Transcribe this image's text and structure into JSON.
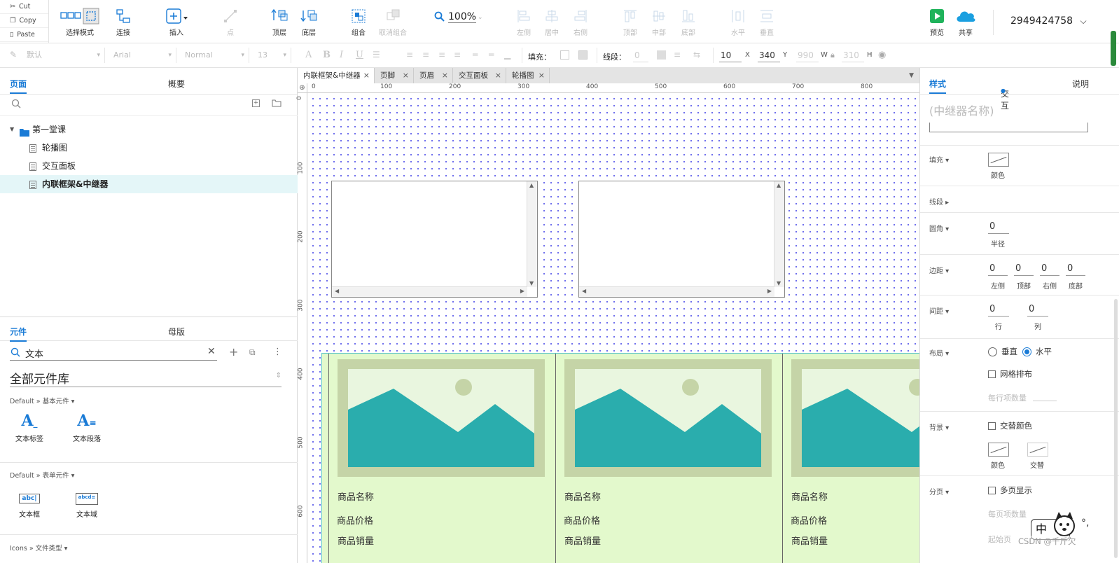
{
  "clipboard": {
    "cut": "Cut",
    "copy": "Copy",
    "paste": "Paste"
  },
  "toolbar": {
    "select_mode": "选择模式",
    "connect": "连接",
    "insert": "插入",
    "point": "点",
    "top_layer": "顶层",
    "bottom_layer": "底层",
    "group": "组合",
    "ungroup": "取消组合",
    "zoom": "100%",
    "align_left": "左侧",
    "align_center": "居中",
    "align_right": "右侧",
    "align_top": "顶部",
    "align_middle": "中部",
    "align_bottom": "底部",
    "dist_h": "水平",
    "dist_v": "垂直",
    "preview": "预览",
    "share": "共享",
    "account": "2949424758"
  },
  "format_bar": {
    "style": "默认",
    "font": "Arial",
    "weight": "Normal",
    "size": "13",
    "fill_label": "填充：",
    "stroke_label": "线段：",
    "stroke_value": "0",
    "x": "10",
    "x_label": "X",
    "y": "340",
    "y_label": "Y",
    "w": "990",
    "w_label": "W",
    "h": "310",
    "h_label": "H"
  },
  "left_panel": {
    "tabs": {
      "pages": "页面",
      "outline": "概要"
    },
    "folder": "第一堂课",
    "pages": [
      "轮播图",
      "交互面板",
      "内联框架&中继器"
    ],
    "lib_tabs": {
      "components": "元件",
      "masters": "母版"
    },
    "search_value": "文本",
    "library_name": "全部元件库",
    "section_basic": "Default » 基本元件 ▾",
    "basic_items": [
      "文本标签",
      "文本段落"
    ],
    "section_form": "Default » 表单元件 ▾",
    "form_items": [
      "文本框",
      "文本域"
    ],
    "section_icons": "Icons » 文件类型 ▾"
  },
  "doc_tabs": [
    "内联框架&中继器",
    "页脚",
    "页眉",
    "交互面板",
    "轮播图"
  ],
  "ruler": {
    "h_ticks": [
      "0",
      "100",
      "200",
      "300",
      "400",
      "500",
      "600",
      "700",
      "800"
    ],
    "v_ticks": [
      "0",
      "100",
      "200",
      "300",
      "400",
      "500",
      "600"
    ]
  },
  "repeater": {
    "items": [
      {
        "name": "商品名称",
        "price": "商品价格",
        "sales": "商品销量"
      },
      {
        "name": "商品名称",
        "price": "商品价格",
        "sales": "商品销量"
      },
      {
        "name": "商品名称",
        "price": "商品价格",
        "sales": "商品销量"
      }
    ]
  },
  "right_panel": {
    "tabs": {
      "style": "样式",
      "interaction": "交互",
      "notes": "说明"
    },
    "name_placeholder": "(中继器名称)",
    "fill_label": "填充 ▾",
    "fill_color": "颜色",
    "stroke_label": "线段 ▸",
    "radius_label": "圆角 ▾",
    "radius_value": "0",
    "radius_sub": "半径",
    "padding_label": "边距 ▾",
    "padding_values": [
      "0",
      "0",
      "0",
      "0"
    ],
    "padding_subs": [
      "左侧",
      "顶部",
      "右侧",
      "底部"
    ],
    "spacing_label": "间距 ▾",
    "spacing_values": [
      "0",
      "0"
    ],
    "spacing_subs": [
      "行",
      "列"
    ],
    "layout_label": "布局 ▾",
    "layout_vertical": "垂直",
    "layout_horizontal": "水平",
    "grid_layout": "网格排布",
    "items_per_row": "每行项数量",
    "bg_label": "背景 ▾",
    "alt_color": "交替颜色",
    "bg_color": "颜色",
    "bg_alt": "交替",
    "paging_label": "分页 ▾",
    "multi_page": "多页显示",
    "items_per_page": "每页项数量",
    "start_page": "起始页"
  },
  "watermark": "CSDN @千斤欠",
  "ime": "中"
}
